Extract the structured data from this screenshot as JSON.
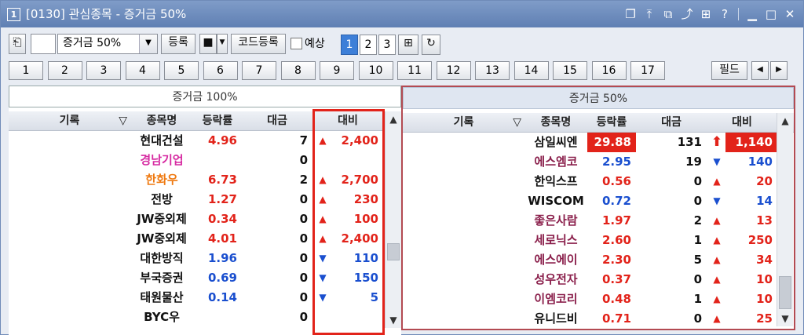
{
  "window": {
    "number_badge": "1",
    "title": "[0130] 관심종목 - 증거금 50%",
    "icons": [
      "window-icon",
      "pin-icon",
      "copy-icon",
      "upload-icon",
      "grid-icon",
      "help-icon",
      "minimize-icon",
      "maximize-icon",
      "close-icon"
    ],
    "help_text": "?"
  },
  "toolbar": {
    "combo_value": "증거금 50%",
    "register_label": "등록",
    "code_register_label": "코드등록",
    "predict_label": "예상",
    "pages": [
      "1",
      "2",
      "3"
    ],
    "active_page": "1"
  },
  "tabs": [
    "1",
    "2",
    "3",
    "4",
    "5",
    "6",
    "7",
    "8",
    "9",
    "10",
    "11",
    "12",
    "13",
    "14",
    "15",
    "16",
    "17"
  ],
  "field_label": "필드",
  "left_panel": {
    "title": "증거금 100%",
    "headers": {
      "record": "기록",
      "name": "종목명",
      "rate": "등락률",
      "volume": "대금",
      "diff": "대비"
    },
    "rows": [
      {
        "name": "현대건설",
        "name_color": "black",
        "rate": "4.96",
        "rate_color": "red",
        "volume": "7",
        "arrow": "▲",
        "arrow_color": "red",
        "diff": "2,400",
        "diff_color": "red"
      },
      {
        "name": "경남기업",
        "name_color": "pink",
        "rate": "",
        "rate_color": "black",
        "volume": "0",
        "arrow": "",
        "arrow_color": "black",
        "diff": "",
        "diff_color": "black"
      },
      {
        "name": "한화우",
        "name_color": "orange",
        "rate": "6.73",
        "rate_color": "red",
        "volume": "2",
        "arrow": "▲",
        "arrow_color": "red",
        "diff": "2,700",
        "diff_color": "red"
      },
      {
        "name": "전방",
        "name_color": "black",
        "rate": "1.27",
        "rate_color": "red",
        "volume": "0",
        "arrow": "▲",
        "arrow_color": "red",
        "diff": "230",
        "diff_color": "red"
      },
      {
        "name": "JW중외제",
        "name_color": "black",
        "rate": "0.34",
        "rate_color": "red",
        "volume": "0",
        "arrow": "▲",
        "arrow_color": "red",
        "diff": "100",
        "diff_color": "red"
      },
      {
        "name": "JW중외제",
        "name_color": "black",
        "rate": "4.01",
        "rate_color": "red",
        "volume": "0",
        "arrow": "▲",
        "arrow_color": "red",
        "diff": "2,400",
        "diff_color": "red"
      },
      {
        "name": "대한방직",
        "name_color": "black",
        "rate": "1.96",
        "rate_color": "blue",
        "volume": "0",
        "arrow": "▼",
        "arrow_color": "blue",
        "diff": "110",
        "diff_color": "blue"
      },
      {
        "name": "부국증권",
        "name_color": "black",
        "rate": "0.69",
        "rate_color": "blue",
        "volume": "0",
        "arrow": "▼",
        "arrow_color": "blue",
        "diff": "150",
        "diff_color": "blue"
      },
      {
        "name": "태원물산",
        "name_color": "black",
        "rate": "0.14",
        "rate_color": "blue",
        "volume": "0",
        "arrow": "▼",
        "arrow_color": "blue",
        "diff": "5",
        "diff_color": "blue"
      },
      {
        "name": "BYC우",
        "name_color": "black",
        "rate": "",
        "rate_color": "black",
        "volume": "0",
        "arrow": "",
        "arrow_color": "black",
        "diff": "",
        "diff_color": "black"
      }
    ]
  },
  "right_panel": {
    "title": "증거금 50%",
    "headers": {
      "record": "기록",
      "name": "종목명",
      "rate": "등락률",
      "volume": "대금",
      "diff": "대비"
    },
    "rows": [
      {
        "name": "삼일씨엔",
        "name_color": "black",
        "rate": "29.88",
        "rate_color": "white-on-red",
        "volume": "131",
        "arrow": "⬆",
        "arrow_color": "red",
        "diff": "1,140",
        "diff_color": "white-on-red"
      },
      {
        "name": "에스엠코",
        "name_color": "maroon",
        "rate": "2.95",
        "rate_color": "blue",
        "volume": "19",
        "arrow": "▼",
        "arrow_color": "blue",
        "diff": "140",
        "diff_color": "blue"
      },
      {
        "name": "한익스프",
        "name_color": "black",
        "rate": "0.56",
        "rate_color": "red",
        "volume": "0",
        "arrow": "▲",
        "arrow_color": "red",
        "diff": "20",
        "diff_color": "red"
      },
      {
        "name": "WISCOM",
        "name_color": "black",
        "rate": "0.72",
        "rate_color": "blue",
        "volume": "0",
        "arrow": "▼",
        "arrow_color": "blue",
        "diff": "14",
        "diff_color": "blue"
      },
      {
        "name": "좋은사람",
        "name_color": "maroon",
        "rate": "1.97",
        "rate_color": "red",
        "volume": "2",
        "arrow": "▲",
        "arrow_color": "red",
        "diff": "13",
        "diff_color": "red"
      },
      {
        "name": "세로닉스",
        "name_color": "maroon",
        "rate": "2.60",
        "rate_color": "red",
        "volume": "1",
        "arrow": "▲",
        "arrow_color": "red",
        "diff": "250",
        "diff_color": "red"
      },
      {
        "name": "에스에이",
        "name_color": "maroon",
        "rate": "2.30",
        "rate_color": "red",
        "volume": "5",
        "arrow": "▲",
        "arrow_color": "red",
        "diff": "34",
        "diff_color": "red"
      },
      {
        "name": "성우전자",
        "name_color": "maroon",
        "rate": "0.37",
        "rate_color": "red",
        "volume": "0",
        "arrow": "▲",
        "arrow_color": "red",
        "diff": "10",
        "diff_color": "red"
      },
      {
        "name": "이엠코리",
        "name_color": "maroon",
        "rate": "0.48",
        "rate_color": "red",
        "volume": "1",
        "arrow": "▲",
        "arrow_color": "red",
        "diff": "10",
        "diff_color": "red"
      },
      {
        "name": "유니드비",
        "name_color": "black",
        "rate": "0.71",
        "rate_color": "red",
        "volume": "0",
        "arrow": "▲",
        "arrow_color": "red",
        "diff": "25",
        "diff_color": "red"
      }
    ]
  },
  "colors": {
    "highlight_red": "#e2231a",
    "blue": "#1a4fcf",
    "pink": "#d62aa1",
    "orange": "#ef7a12",
    "maroon": "#8a1f4b",
    "title_bar": "#6f8bb8"
  }
}
